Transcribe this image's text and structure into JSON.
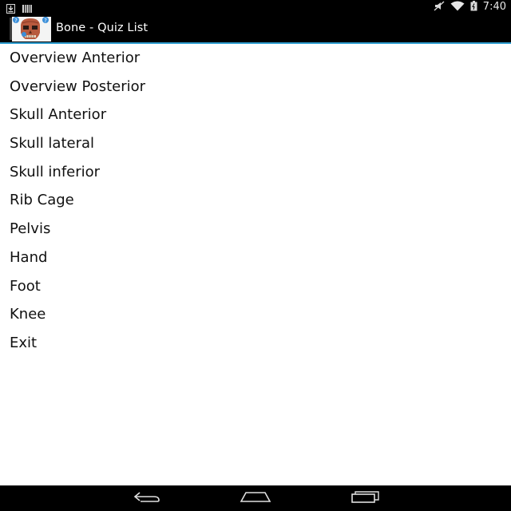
{
  "status_bar": {
    "time": "7:40"
  },
  "action_bar": {
    "title": "Bone - Quiz List"
  },
  "quiz_list": {
    "items": [
      "Overview Anterior",
      "Overview Posterior",
      "Skull Anterior",
      "Skull lateral",
      "Skull inferior",
      "Rib Cage",
      "Pelvis",
      "Hand",
      "Foot",
      "Knee",
      "Exit"
    ]
  },
  "icons": {
    "status_left": [
      "download-icon",
      "barcode-icon"
    ],
    "status_right": [
      "mute-icon",
      "wifi-icon",
      "battery-icon"
    ],
    "nav": [
      "back-icon",
      "home-icon",
      "recents-icon"
    ]
  },
  "colors": {
    "bar_background": "#000000",
    "action_bar_divider": "#2f9ed0",
    "list_background": "#ffffff",
    "list_text": "#111111"
  }
}
